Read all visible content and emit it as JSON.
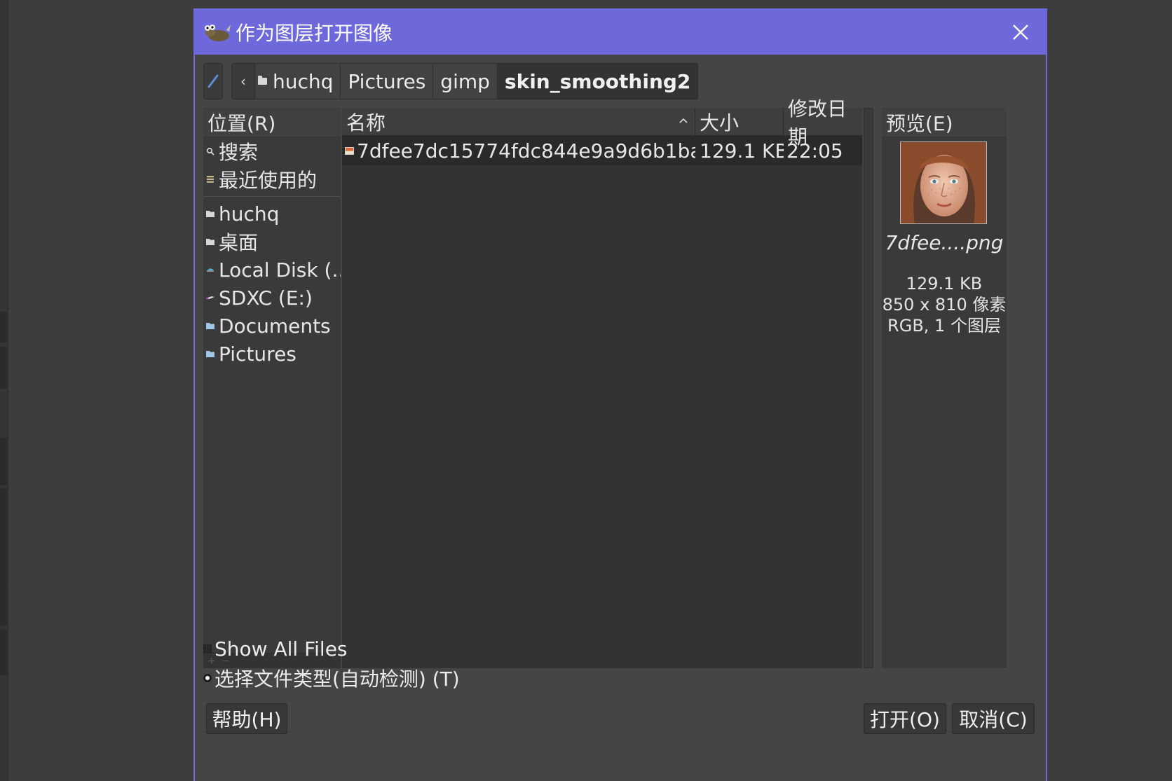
{
  "dialog": {
    "title": "作为图层打开图像",
    "icons": {
      "app": "gimp-wilber-icon",
      "close": "close-icon"
    }
  },
  "pathbar": {
    "crumbs": [
      "huchq",
      "Pictures",
      "gimp",
      "skin_smoothing2"
    ],
    "current": "skin_smoothing2"
  },
  "places": {
    "header": "位置(R)",
    "items": [
      {
        "label": "搜索",
        "icon": "search-icon"
      },
      {
        "label": "最近使用的",
        "icon": "recent-icon"
      },
      {
        "label": "huchq",
        "icon": "folder-icon"
      },
      {
        "label": "桌面",
        "icon": "folder-icon"
      },
      {
        "label": "Local Disk (...",
        "icon": "drive-icon"
      },
      {
        "label": "SDXC (E:)",
        "icon": "removable-drive-icon"
      },
      {
        "label": "Documents",
        "icon": "folder-icon"
      },
      {
        "label": "Pictures",
        "icon": "folder-icon"
      }
    ]
  },
  "filelist": {
    "columns": {
      "name": "名称",
      "size": "大小",
      "modified": "修改日期"
    },
    "rows": [
      {
        "name": "7dfee7dc15774fdc844e9a9d6b1ba...",
        "size": "129.1 KB",
        "modified": "22:05"
      }
    ]
  },
  "preview": {
    "header": "预览(E)",
    "filename": "7dfee....png",
    "size": "129.1 KB",
    "dimensions": "850 x 810 像素",
    "mode": "RGB, 1 个图层"
  },
  "options": {
    "show_all_files": "Show All Files",
    "file_type": "选择文件类型(自动检测) (T)"
  },
  "buttons": {
    "help": "帮助(H)",
    "open": "打开(O)",
    "cancel": "取消(C)"
  },
  "colors": {
    "titlebar": "#6e69da",
    "dialog_bg": "#454545",
    "list_bg": "#333333"
  }
}
